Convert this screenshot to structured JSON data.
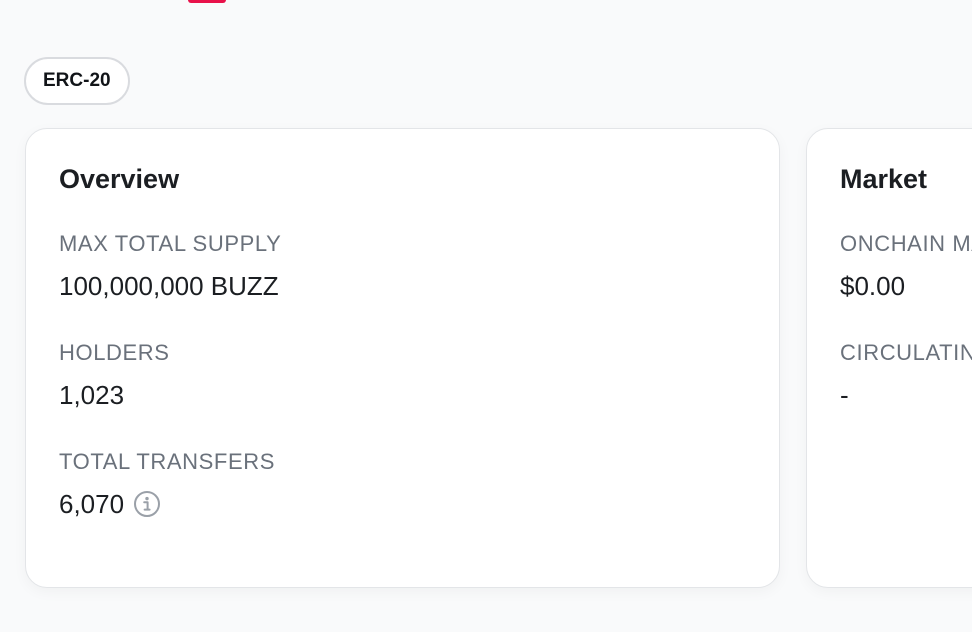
{
  "token_standard": "ERC-20",
  "overview": {
    "title": "Overview",
    "max_total_supply": {
      "label": "MAX TOTAL SUPPLY",
      "value": "100,000,000 BUZZ"
    },
    "holders": {
      "label": "HOLDERS",
      "value": "1,023"
    },
    "total_transfers": {
      "label": "TOTAL TRANSFERS",
      "value": "6,070",
      "icon": "info-icon"
    }
  },
  "market": {
    "title": "Market",
    "onchain_market_cap": {
      "label": "ONCHAIN MARKET CAP",
      "value": "$0.00"
    },
    "circulating_supply": {
      "label": "CIRCULATING SUPPLY MARKET CAP",
      "value": "-"
    }
  },
  "colors": {
    "accent": "#e8114a",
    "muted_text": "#6a717b",
    "border": "#e3e5e8"
  }
}
